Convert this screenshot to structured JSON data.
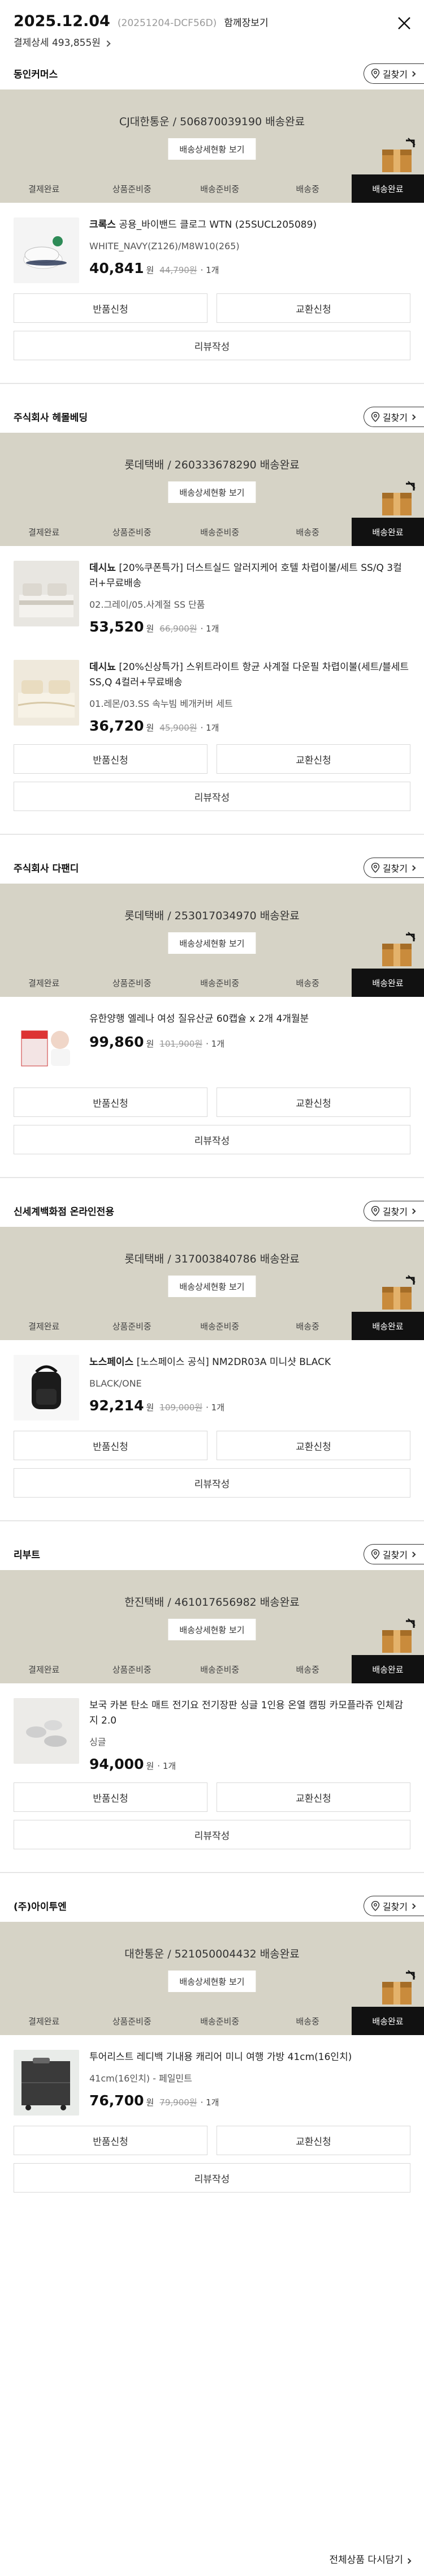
{
  "order": {
    "date": "2025.12.04",
    "order_no": "(20251204-DCF56D)",
    "receipt_label": "함께장보기",
    "payment_label": "결제상세 493,855원"
  },
  "labels": {
    "track": "길찾기",
    "detail": "배송상세현황 보기",
    "return": "반품신청",
    "exchange": "교환신청",
    "review": "리뷰작성",
    "won": "원",
    "see_all": "전체상품 다시담기"
  },
  "steps": [
    "결제완료",
    "상품준비중",
    "배송준비중",
    "배송중",
    "배송완료"
  ],
  "groups": [
    {
      "seller": "동인커머스",
      "courier": "CJ대한통운 / 506870039190 배송완료",
      "products": [
        {
          "brand": "크록스",
          "title": "공용_바이밴드 클로그 WTN (25SUCL205089)",
          "option": "WHITE_NAVY(Z126)/M8W10(265)",
          "price": "40,841",
          "orig": "44,790원",
          "qty": "· 1개",
          "thumb": "clog"
        }
      ]
    },
    {
      "seller": "주식회사 헤몰베딩",
      "courier": "롯데택배 / 260333678290 배송완료",
      "products": [
        {
          "brand": "데시뇨",
          "title": "[20%쿠폰특가] 더스트실드 알러지케어 호텔 차렵이불/세트 SS/Q 3컬러+무료배송",
          "option": "02.그레이/05.사계절 SS 단품",
          "price": "53,520",
          "orig": "66,900원",
          "qty": "· 1개",
          "thumb": "bed"
        },
        {
          "brand": "데시뇨",
          "title": "[20%신상특가] 스위트라이트 항균 사계절 다운필 차렵이불(세트/블세트 SS,Q 4컬러+무료배송",
          "option": "01.레몬/03.SS 속누빔 베개커버 세트",
          "price": "36,720",
          "orig": "45,900원",
          "qty": "· 1개",
          "thumb": "bed2"
        }
      ]
    },
    {
      "seller": "주식회사 다팬디",
      "courier": "롯데택배 / 253017034970 배송완료",
      "products": [
        {
          "brand": "",
          "title": "유한양행 엘레나 여성 질유산균 60캡슐 x 2개 4개월분",
          "option": "",
          "price": "99,860",
          "orig": "101,900원",
          "qty": "· 1개",
          "thumb": "supp"
        }
      ]
    },
    {
      "seller": "신세계백화점 온라인전용",
      "courier": "롯데택배 / 317003840786 배송완료",
      "products": [
        {
          "brand": "노스페이스",
          "title": "[노스페이스 공식] NM2DR03A 미니샷 BLACK",
          "option": "BLACK/ONE",
          "price": "92,214",
          "orig": "109,000원",
          "qty": "· 1개",
          "thumb": "bag"
        }
      ]
    },
    {
      "seller": "리부트",
      "courier": "한진택배 / 461017656982 배송완료",
      "products": [
        {
          "brand": "",
          "title": "보국 카본 탄소 매트 전기요 전기장판 싱글 1인용 온열 캠핑 카모플라쥬 인체감지 2.0",
          "option": "싱글",
          "price": "94,000",
          "orig": "",
          "qty": "· 1개",
          "thumb": "mat"
        }
      ]
    },
    {
      "seller": "(주)아이투엔",
      "courier": "대한통운 / 521050004432 배송완료",
      "products": [
        {
          "brand": "",
          "title": "투어리스트 레디백 기내용 캐리어 미니 여행 가방 41cm(16인치)",
          "option": "41cm(16인치) - 페일민트",
          "price": "76,700",
          "orig": "79,900원",
          "qty": "· 1개",
          "thumb": "carrier"
        }
      ]
    }
  ]
}
